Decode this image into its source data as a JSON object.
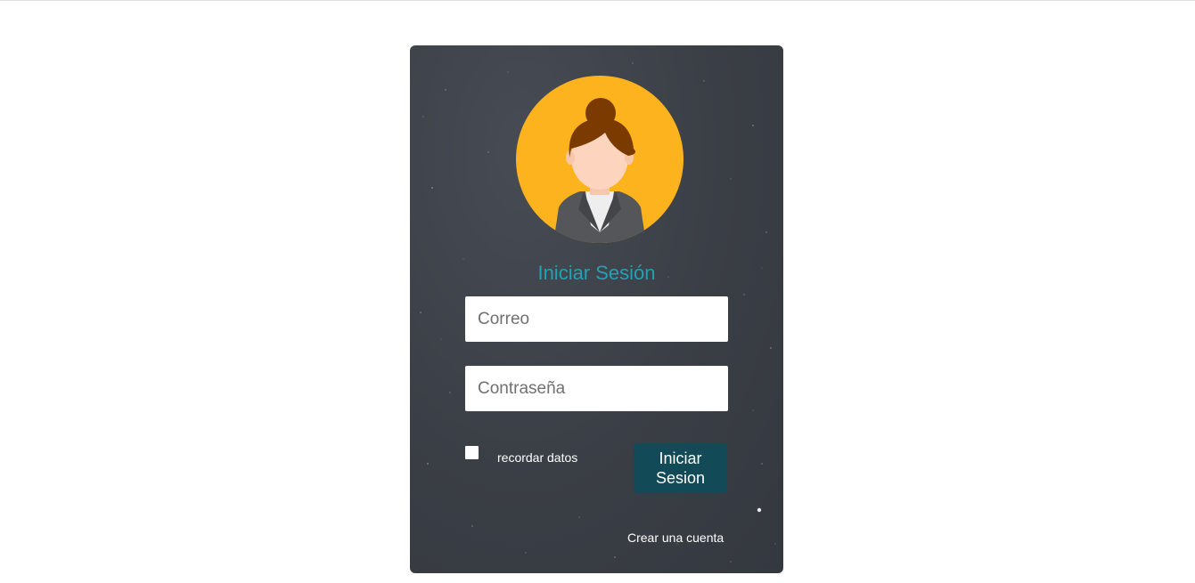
{
  "colors": {
    "card_background": "#3a3e45",
    "title_accent": "#1fa3b5",
    "button_background": "#124a57",
    "avatar_circle": "#fdb31d"
  },
  "login": {
    "avatar_icon": "woman-user-avatar-icon",
    "title": "Iniciar Sesión",
    "email": {
      "placeholder": "Correo",
      "value": ""
    },
    "password": {
      "placeholder": "Contraseña",
      "value": ""
    },
    "remember_label": "recordar datos",
    "remember_checked": false,
    "submit_label": "Iniciar Sesion",
    "create_account_label": "Crear una cuenta"
  }
}
